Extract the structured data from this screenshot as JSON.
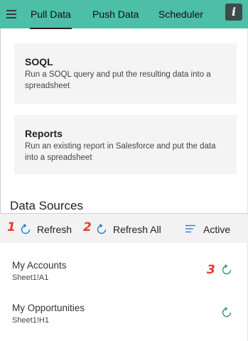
{
  "nav": {
    "tabs": [
      {
        "label": "Pull Data",
        "active": true
      },
      {
        "label": "Push Data",
        "active": false
      },
      {
        "label": "Scheduler",
        "active": false
      }
    ],
    "info_label": "i",
    "menu_icon": "hamburger-icon"
  },
  "cards": [
    {
      "title": "SOQL",
      "description": "Run a SOQL query and put the resulting data into a spreadsheet"
    },
    {
      "title": "Reports",
      "description": "Run an existing report in Salesforce and put the data into a spreadsheet"
    }
  ],
  "data_sources": {
    "title": "Data Sources",
    "toolbar": {
      "refresh_marker": "1",
      "refresh_label": "Refresh",
      "refresh_all_marker": "2",
      "refresh_all_label": "Refresh All",
      "filter_label": "Active"
    },
    "items": [
      {
        "name": "My Accounts",
        "range": "Sheet1!A1",
        "marker": "3"
      },
      {
        "name": "My Opportunities",
        "range": "Sheet1!H1",
        "marker": ""
      }
    ]
  },
  "colors": {
    "header_bg": "#4cbfa6",
    "refresh_icon": "#2b7fd4",
    "row_refresh_icon": "#2a8b78",
    "marker": "#e63b2e"
  }
}
